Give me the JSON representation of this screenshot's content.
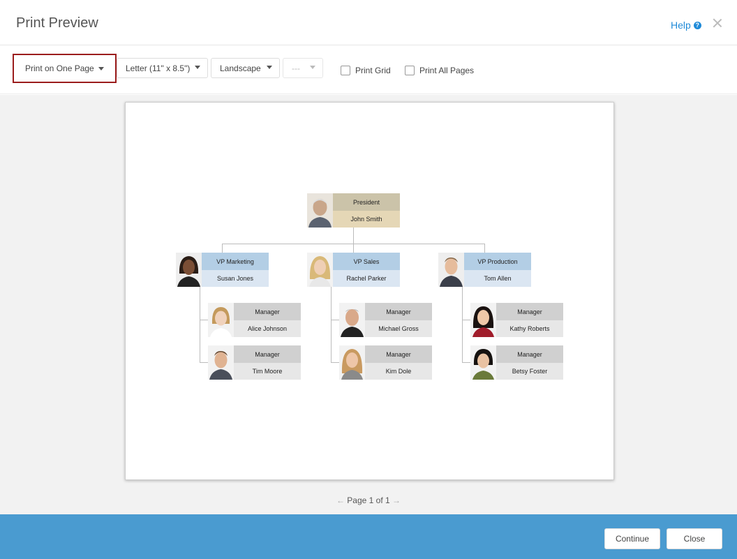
{
  "header": {
    "title": "Print Preview",
    "help_label": "Help",
    "help_icon": "?"
  },
  "toolbar": {
    "scale": "Print on One Page",
    "paper": "Letter (11\" x 8.5\")",
    "orientation": "Landscape",
    "pages_select": "---",
    "print_grid": "Print Grid",
    "print_all_pages": "Print All Pages"
  },
  "org": {
    "president": {
      "role": "President",
      "name": "John Smith"
    },
    "vps": [
      {
        "role": "VP Marketing",
        "name": "Susan Jones"
      },
      {
        "role": "VP Sales",
        "name": "Rachel Parker"
      },
      {
        "role": "VP Production",
        "name": "Tom Allen"
      }
    ],
    "managers": [
      {
        "role": "Manager",
        "name": "Alice Johnson"
      },
      {
        "role": "Manager",
        "name": "Tim Moore"
      },
      {
        "role": "Manager",
        "name": "Michael Gross"
      },
      {
        "role": "Manager",
        "name": "Kim Dole"
      },
      {
        "role": "Manager",
        "name": "Kathy Roberts"
      },
      {
        "role": "Manager",
        "name": "Betsy Foster"
      }
    ]
  },
  "pager": {
    "prev_icon": "←",
    "label": "Page 1 of 1",
    "next_icon": "→"
  },
  "footer": {
    "continue_label": "Continue",
    "close_label": "Close"
  },
  "colors": {
    "footer_bar": "#4a9bd0",
    "highlight_border": "#9b1c1c",
    "link": "#1f8ad8"
  }
}
